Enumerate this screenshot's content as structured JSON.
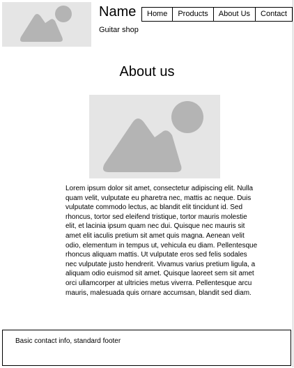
{
  "header": {
    "name": "Name",
    "subtitle": "Guitar shop",
    "logo_icon": "image-placeholder-icon"
  },
  "nav": {
    "items": [
      {
        "label": "Home"
      },
      {
        "label": "Products"
      },
      {
        "label": "About Us"
      },
      {
        "label": "Contact"
      }
    ]
  },
  "main": {
    "title": "About us",
    "hero_icon": "image-placeholder-icon",
    "body": "Lorem ipsum dolor sit amet, consectetur adipiscing elit. Nulla quam velit, vulputate eu pharetra nec, mattis ac neque. Duis vulputate commodo lectus, ac blandit elit tincidunt id. Sed rhoncus, tortor sed eleifend tristique, tortor mauris molestie elit, et lacinia ipsum quam nec dui. Quisque nec mauris sit amet elit iaculis pretium sit amet quis magna. Aenean velit odio, elementum in tempus ut, vehicula eu diam. Pellentesque rhoncus aliquam mattis. Ut vulputate eros sed felis sodales nec vulputate justo hendrerit. Vivamus varius pretium ligula, a aliquam odio euismod sit amet. Quisque laoreet sem sit amet orci ullamcorper at ultricies metus viverra. Pellentesque arcu mauris, malesuada quis ornare accumsan, blandit sed diam."
  },
  "footer": {
    "text": "Basic contact info, standard footer"
  },
  "colors": {
    "placeholder_bg": "#e5e5e5",
    "placeholder_shape": "#b4b4b4",
    "border": "#000000"
  }
}
